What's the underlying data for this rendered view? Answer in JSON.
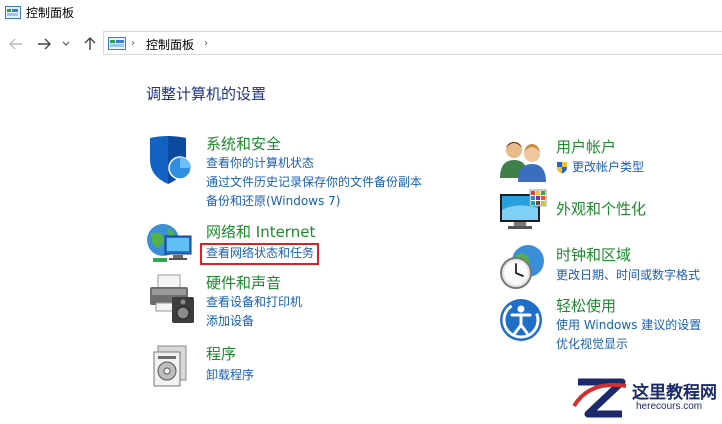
{
  "window": {
    "title": "控制面板"
  },
  "addressbar": {
    "breadcrumb": "控制面板"
  },
  "main": {
    "heading": "调整计算机的设置",
    "left": [
      {
        "title": "系统和安全",
        "links": [
          "查看你的计算机状态",
          "通过文件历史记录保存你的文件备份副本",
          "备份和还原(Windows 7)"
        ]
      },
      {
        "title": "网络和 Internet",
        "links": [
          "查看网络状态和任务"
        ]
      },
      {
        "title": "硬件和声音",
        "links": [
          "查看设备和打印机",
          "添加设备"
        ]
      },
      {
        "title": "程序",
        "links": [
          "卸载程序"
        ]
      }
    ],
    "right": [
      {
        "title": "用户帐户",
        "links": [
          "更改帐户类型"
        ]
      },
      {
        "title": "外观和个性化",
        "links": []
      },
      {
        "title": "时钟和区域",
        "links": [
          "更改日期、时间或数字格式"
        ]
      },
      {
        "title": "轻松使用",
        "links": [
          "使用 Windows 建议的设置",
          "优化视觉显示"
        ]
      }
    ]
  },
  "watermark": {
    "name": "这里教程网",
    "url": "herecours.com"
  },
  "colors": {
    "category_title": "#1e8a2e",
    "link": "#1a5fb4",
    "heading": "#1e3287",
    "highlight": "#e02020"
  }
}
